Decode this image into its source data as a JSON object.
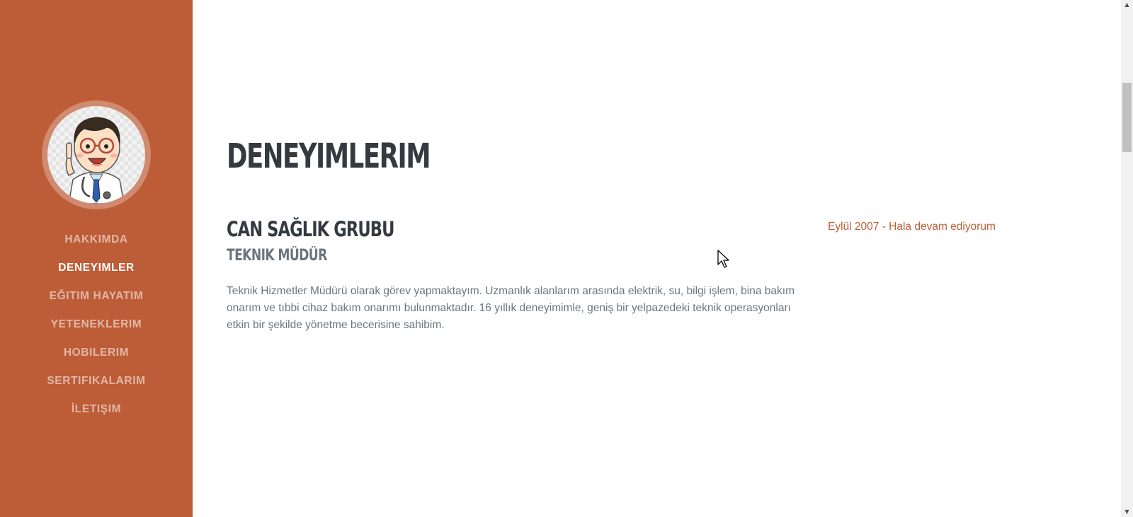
{
  "sidebar": {
    "avatar_alt": "doctor-cartoon-avatar",
    "nav_items": [
      {
        "label": "HAKKIMDA",
        "active": false
      },
      {
        "label": "DENEYIMLER",
        "active": true
      },
      {
        "label": "EĞITIM HAYATIM",
        "active": false
      },
      {
        "label": "YETENEKLERIM",
        "active": false
      },
      {
        "label": "HOBILERIM",
        "active": false
      },
      {
        "label": "SERTIFIKALARIM",
        "active": false
      },
      {
        "label": "İLETIŞIM",
        "active": false
      }
    ]
  },
  "main": {
    "section_title": "DENEYIMLERIM",
    "experience": {
      "company": "CAN SAĞLIK GRUBU",
      "role": "TEKNIK MÜDÜR",
      "description": "Teknik Hizmetler Müdürü olarak görev yapmaktayım. Uzmanlık alanlarım arasında elektrik, su, bilgi işlem, bina bakım onarım ve tıbbi cihaz bakım onarımı bulunmaktadır. 16 yıllık deneyimimle, geniş bir yelpazedeki teknik operasyonları etkin bir şekilde yönetme becerisine sahibim.",
      "date": "Eylül 2007 - Hala devam ediyorum"
    }
  },
  "scrollbar": {
    "up_arrow": "▲",
    "down_arrow": "▼"
  },
  "colors": {
    "sidebar_bg": "#bd5d38",
    "heading": "#343a40",
    "muted_text": "#6c757d",
    "accent": "#bd5d38"
  }
}
